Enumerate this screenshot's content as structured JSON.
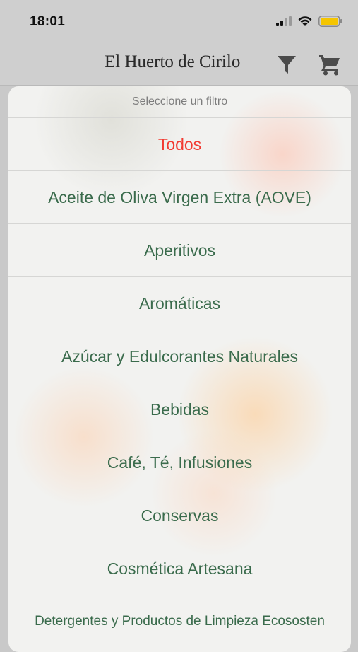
{
  "status_bar": {
    "time": "18:01",
    "icons": [
      "signal-icon",
      "wifi-icon",
      "battery-icon"
    ],
    "battery_color": "#f5c500"
  },
  "nav": {
    "title": "El Huerto de Cirilo",
    "filter_icon": "filter-icon",
    "cart_icon": "cart-icon"
  },
  "sheet": {
    "header": "Seleccione un filtro",
    "options": [
      {
        "label": "Todos",
        "selected": true
      },
      {
        "label": "Aceite de Oliva Virgen Extra (AOVE)"
      },
      {
        "label": "Aperitivos"
      },
      {
        "label": "Aromáticas"
      },
      {
        "label": "Azúcar y Edulcorantes Naturales"
      },
      {
        "label": "Bebidas"
      },
      {
        "label": "Café, Té, Infusiones"
      },
      {
        "label": "Conservas"
      },
      {
        "label": "Cosmética Artesana"
      },
      {
        "label": "Detergentes y Productos de Limpieza Ecososten"
      }
    ]
  },
  "colors": {
    "option_text": "#3a6b4c",
    "selected_text": "#f23b32",
    "header_text": "#7d7d7d"
  }
}
